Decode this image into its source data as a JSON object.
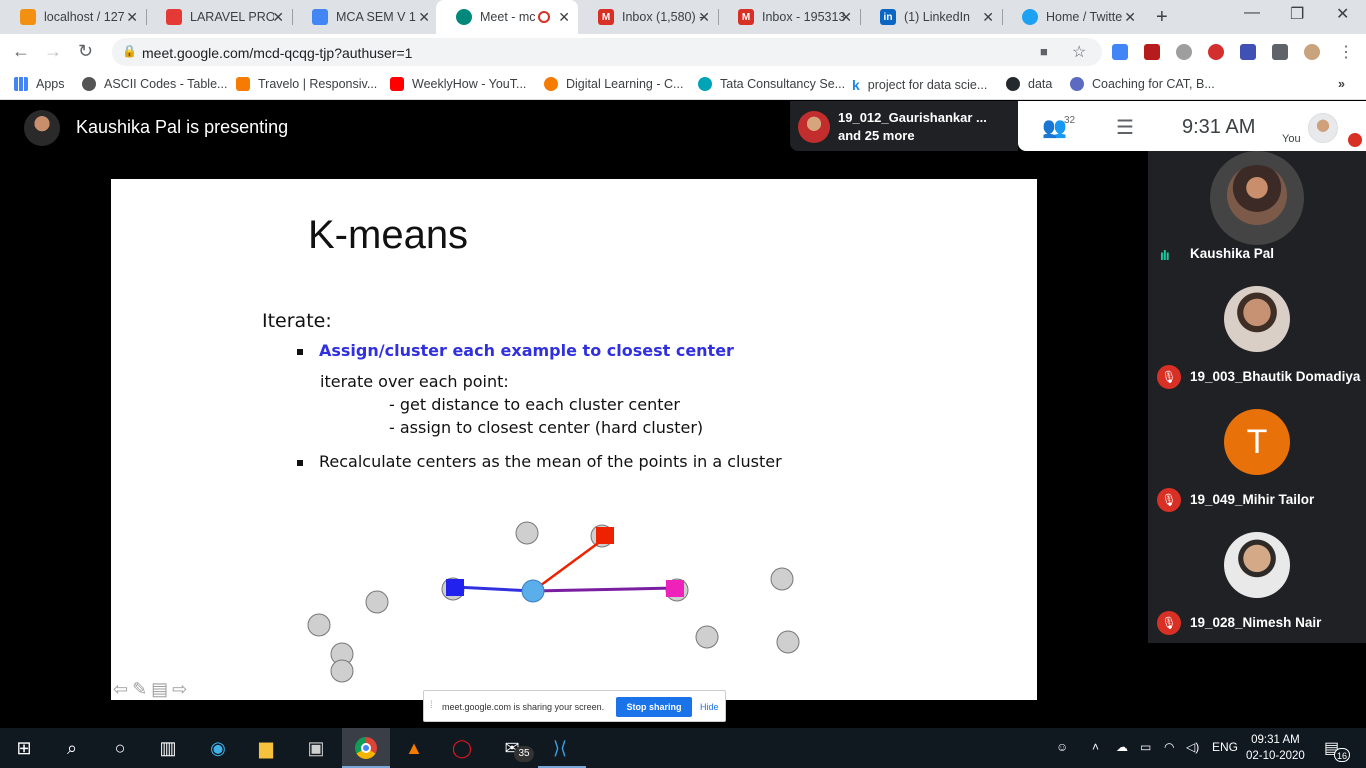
{
  "browser": {
    "tabs": [
      {
        "label": "localhost / 127",
        "favicon_color": "#f29111",
        "active": false
      },
      {
        "label": "LARAVEL PRO",
        "favicon_color": "#e53935",
        "active": false
      },
      {
        "label": "MCA SEM V 1",
        "favicon_color": "#4285f4",
        "active": false
      },
      {
        "label": "Meet - mc",
        "favicon_color": "#00897b",
        "active": true
      },
      {
        "label": "Inbox (1,580) -",
        "favicon_color": "#d93025",
        "active": false
      },
      {
        "label": "Inbox - 195313",
        "favicon_color": "#d93025",
        "active": false
      },
      {
        "label": "(1) LinkedIn",
        "favicon_color": "#0a66c2",
        "active": false
      },
      {
        "label": "Home / Twitte",
        "favicon_color": "#1da1f2",
        "active": false
      }
    ],
    "url": "meet.google.com/mcd-qcqg-tjp?authuser=1",
    "bookmarks": [
      {
        "label": "Apps",
        "color": "#4285f4"
      },
      {
        "label": "ASCII Codes - Table...",
        "color": "#555555"
      },
      {
        "label": "Travelo | Responsiv...",
        "color": "#f57c00"
      },
      {
        "label": "WeeklyHow - YouT...",
        "color": "#ff0000"
      },
      {
        "label": "Digital Learning - C...",
        "color": "#f57c00"
      },
      {
        "label": "Tata Consultancy Se...",
        "color": "#00a4b4"
      },
      {
        "label": "project for data scie...",
        "color": "#1e88e5"
      },
      {
        "label": "data",
        "color": "#24292e"
      },
      {
        "label": "Coaching for CAT, B...",
        "color": "#5c6bc0"
      }
    ]
  },
  "meet": {
    "presenter_text": "Kaushika Pal is presenting",
    "participants_line1": "19_012_Gaurishankar ...",
    "participants_line2": "and 25 more",
    "people_count": "32",
    "time": "9:31 AM",
    "you_label": "You",
    "share_notice": "meet.google.com is sharing your screen.",
    "stop_sharing": "Stop sharing",
    "hide": "Hide",
    "tiles": [
      {
        "name": "Kaushika Pal",
        "muted": false,
        "avatar_color": "#6d4c41"
      },
      {
        "name": "19_003_Bhautik Domadiya",
        "muted": true,
        "avatar_color": "#8d6e63"
      },
      {
        "name": "19_049_Mihir Tailor",
        "muted": true,
        "avatar_letter": "T",
        "avatar_color": "#e8710a"
      },
      {
        "name": "19_028_Nimesh Nair",
        "muted": true,
        "avatar_color": "#a1887f"
      }
    ]
  },
  "slide": {
    "title": "K-means",
    "iterate": "Iterate:",
    "bullet1": "Assign/cluster each example to closest center",
    "sub1": "iterate over each point:",
    "sub2": "- get distance to each cluster center",
    "sub3": "- assign to closest center (hard cluster)",
    "bullet2": "Recalculate centers as the mean of the points in a cluster"
  },
  "taskbar": {
    "time": "09:31 AM",
    "date": "02-10-2020",
    "language": "ENG",
    "mail_badge": "35",
    "notif_badge": "16"
  }
}
